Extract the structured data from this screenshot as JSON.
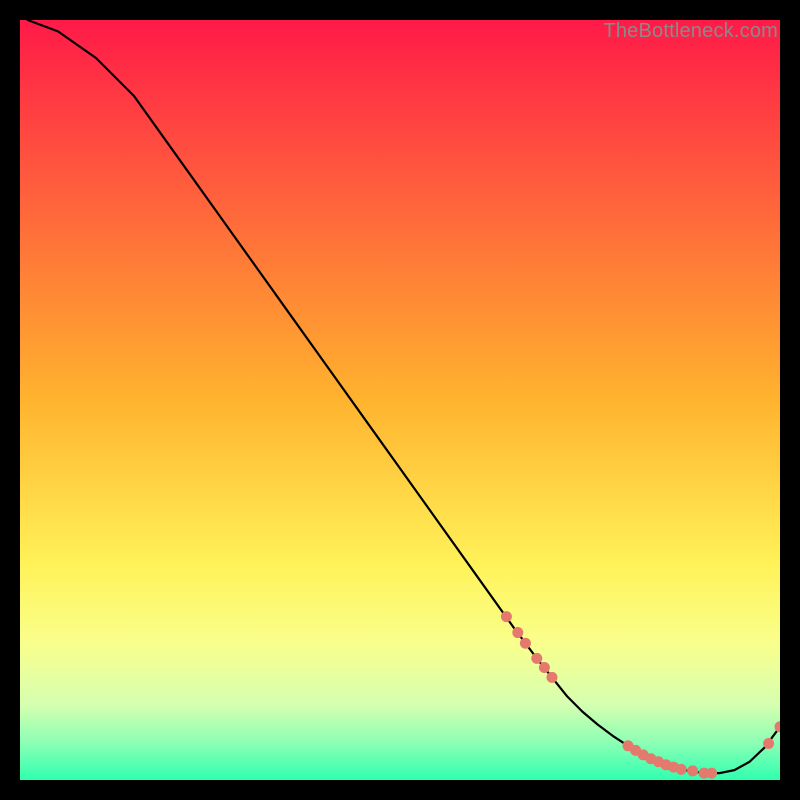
{
  "watermark": "TheBottleneck.com",
  "chart_data": {
    "type": "line",
    "title": "",
    "xlabel": "",
    "ylabel": "",
    "xlim": [
      0,
      100
    ],
    "ylim": [
      0,
      100
    ],
    "grid": false,
    "legend": false,
    "background_gradient": {
      "stops": [
        {
          "offset": 0.0,
          "color": "#ff1a48"
        },
        {
          "offset": 0.5,
          "color": "#ffb32e"
        },
        {
          "offset": 0.72,
          "color": "#fff35a"
        },
        {
          "offset": 0.82,
          "color": "#f9ff8c"
        },
        {
          "offset": 0.9,
          "color": "#d6ffb0"
        },
        {
          "offset": 0.95,
          "color": "#8dffb4"
        },
        {
          "offset": 1.0,
          "color": "#2fffb0"
        }
      ]
    },
    "series": [
      {
        "name": "curve",
        "color": "#000000",
        "x": [
          1,
          5,
          10,
          15,
          20,
          25,
          30,
          35,
          40,
          45,
          50,
          55,
          60,
          65,
          68,
          70,
          72,
          74,
          76,
          78,
          80,
          82,
          84,
          86,
          88,
          90,
          92,
          94,
          96,
          98,
          100
        ],
        "y": [
          100,
          98.5,
          95,
          90,
          83,
          76,
          69,
          62,
          55,
          48,
          41,
          34,
          27,
          20,
          16,
          13.5,
          11,
          9,
          7.3,
          5.8,
          4.5,
          3.3,
          2.4,
          1.7,
          1.2,
          0.9,
          0.9,
          1.3,
          2.4,
          4.3,
          7.0
        ]
      }
    ],
    "markers": [
      {
        "name": "segment-dots",
        "color": "#e4796e",
        "radius_px": 5.5,
        "points": [
          {
            "x": 64.0,
            "y": 21.5
          },
          {
            "x": 65.5,
            "y": 19.4
          },
          {
            "x": 66.5,
            "y": 18.0
          },
          {
            "x": 68.0,
            "y": 16.0
          },
          {
            "x": 69.0,
            "y": 14.8
          },
          {
            "x": 70.0,
            "y": 13.5
          },
          {
            "x": 80.0,
            "y": 4.5
          },
          {
            "x": 81.0,
            "y": 3.9
          },
          {
            "x": 82.0,
            "y": 3.3
          },
          {
            "x": 83.0,
            "y": 2.8
          },
          {
            "x": 84.0,
            "y": 2.4
          },
          {
            "x": 85.0,
            "y": 2.0
          },
          {
            "x": 86.0,
            "y": 1.7
          },
          {
            "x": 87.0,
            "y": 1.4
          },
          {
            "x": 88.5,
            "y": 1.2
          },
          {
            "x": 90.0,
            "y": 0.9
          },
          {
            "x": 91.0,
            "y": 0.9
          },
          {
            "x": 98.5,
            "y": 4.8
          },
          {
            "x": 100.0,
            "y": 7.0
          }
        ]
      }
    ]
  }
}
